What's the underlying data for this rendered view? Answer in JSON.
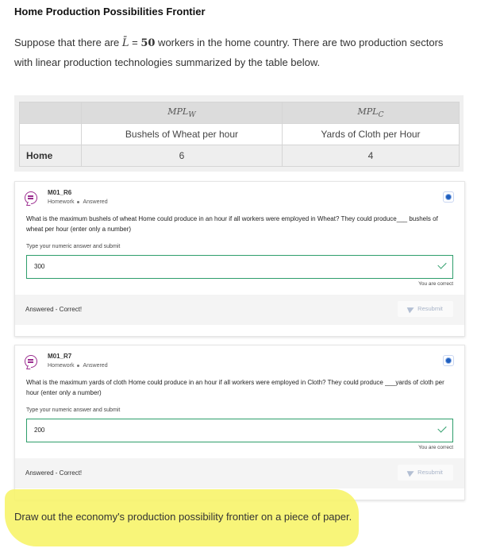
{
  "title": "Home Production Possibilities Frontier",
  "intro": {
    "before": "Suppose that there are ",
    "var": "L̄",
    "eq": " = ",
    "value": "50",
    "after": " workers in the home country.  There are two production sectors with linear production technologies summarized by the table below."
  },
  "table": {
    "headers": [
      "MPL",
      "MPL"
    ],
    "header_subs": [
      "W",
      "C"
    ],
    "units": [
      "Bushels of Wheat per hour",
      "Yards of Cloth per Hour"
    ],
    "row_label": "Home",
    "values": [
      "6",
      "4"
    ]
  },
  "questions": [
    {
      "id": "M01_R6",
      "type": "Homework",
      "state": "Answered",
      "text": "What is the maximum bushels of wheat Home could produce in an hour if all workers were employed in Wheat? They could produce___ bushels of wheat per hour (enter only a number)",
      "instruction": "Type your numeric answer and submit",
      "answer": "300",
      "correct_note": "You are correct",
      "status": "Answered - Correct!",
      "resubmit_label": "Resubmit"
    },
    {
      "id": "M01_R7",
      "type": "Homework",
      "state": "Answered",
      "text": "What is the maximum yards of cloth Home could produce in an hour if all workers were employed in Cloth? They could produce ___yards of cloth per hour (enter only a number)",
      "instruction": "Type your numeric answer and submit",
      "answer": "200",
      "correct_note": "You are correct",
      "status": "Answered - Correct!",
      "resubmit_label": "Resubmit"
    }
  ],
  "final_instruction": "Draw out the economy's production possibility frontier on a piece of paper.",
  "colors": {
    "accent_green": "#2e9e6b",
    "icon_purple": "#9b2d8f",
    "highlight_yellow": "#f7f46a"
  }
}
